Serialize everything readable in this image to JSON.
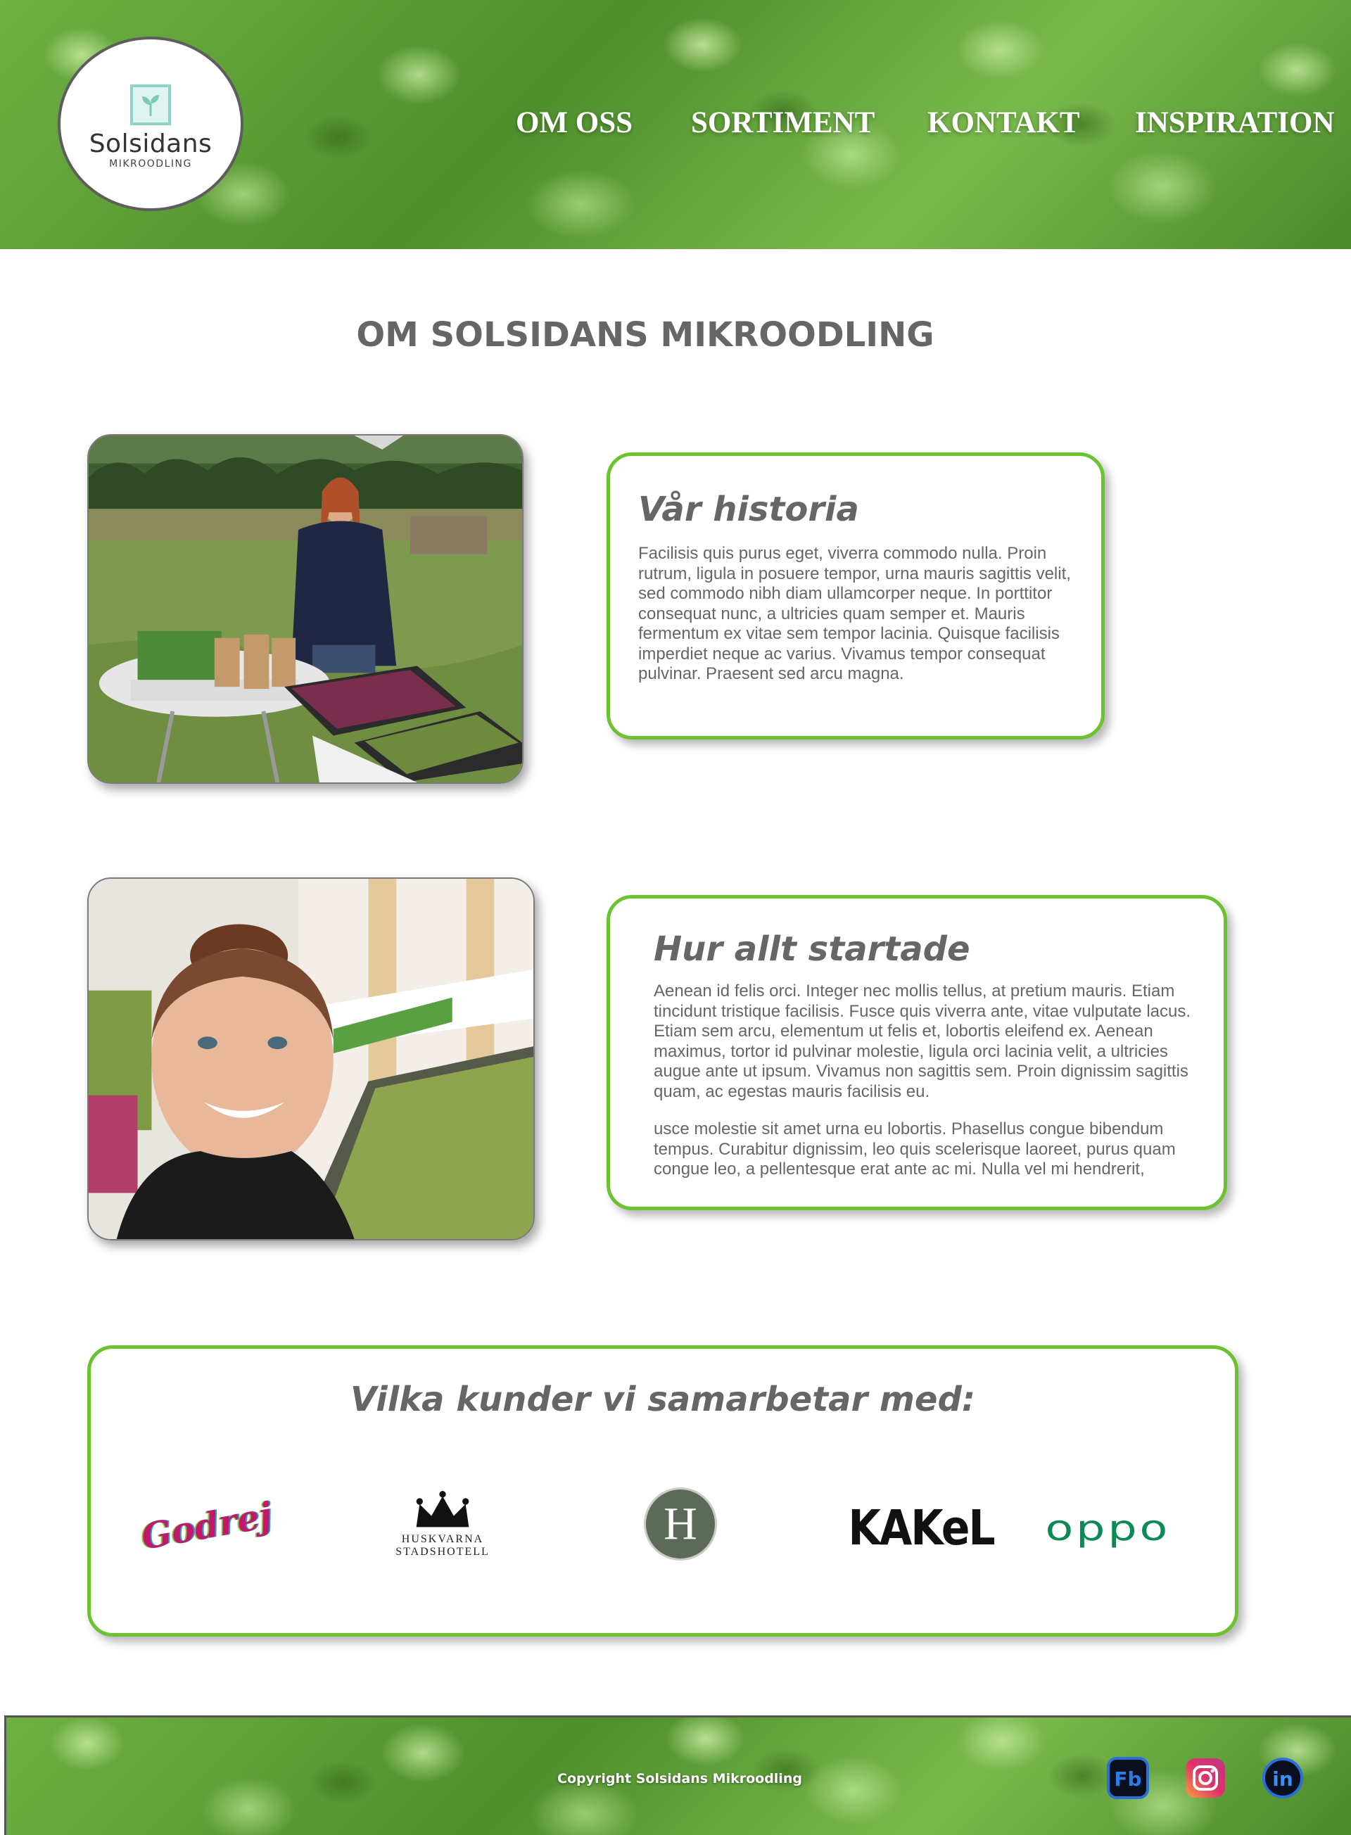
{
  "brand": {
    "name": "Solsidans",
    "tagline": "MIKROODLING"
  },
  "nav": {
    "items": [
      {
        "label": "OM OSS"
      },
      {
        "label": "SORTIMENT"
      },
      {
        "label": "KONTAKT"
      },
      {
        "label": "INSPIRATION"
      }
    ]
  },
  "main": {
    "title": "OM SOLSIDANS MIKROODLING",
    "history": {
      "heading": "Vår historia",
      "text": "Facilisis quis purus eget, viverra commodo nulla. Proin rutrum, ligula in posuere tempor, urna mauris sagittis velit, sed commodo nibh diam ullamcorper neque. In porttitor consequat nunc, a ultricies quam semper et. Mauris fermentum ex vitae sem tempor lacinia. Quisque facilisis imperdiet neque ac varius. Vivamus tempor consequat pulvinar. Praesent sed arcu magna."
    },
    "start": {
      "heading": "Hur allt startade",
      "paragraph1": "Aenean id felis orci. Integer nec mollis tellus, at pretium mauris. Etiam tincidunt tristique facilisis. Fusce quis viverra ante, vitae vulputate lacus. Etiam sem arcu, elementum ut felis et, lobortis eleifend ex. Aenean maximus, tortor id pulvinar molestie, ligula orci lacinia velit, a ultricies augue ante ut ipsum. Vivamus non sagittis sem. Proin dignissim sagittis quam, ac egestas mauris facilisis eu.",
      "paragraph2": "usce molestie sit amet urna eu lobortis. Phasellus congue bibendum tempus. Curabitur dignissim, leo quis scelerisque laoreet, purus quam congue leo, a pellentesque erat ante ac mi. Nulla vel mi hendrerit,"
    },
    "partners": {
      "heading": "Vilka kunder vi samarbetar med:",
      "logos": [
        {
          "name": "godrej",
          "text": "Godrej"
        },
        {
          "name": "huskvarna-stadshotell",
          "line1": "HUSKVARNA",
          "line2": "STADSHOTELL"
        },
        {
          "name": "h-emblem",
          "text": "H"
        },
        {
          "name": "kakel",
          "text": "KAKeL"
        },
        {
          "name": "oppo",
          "text": "oppo"
        }
      ]
    }
  },
  "footer": {
    "copyright": "Copyright Solsidans Mikroodling",
    "social": [
      {
        "name": "facebook",
        "label": "Fb"
      },
      {
        "name": "instagram",
        "label": ""
      },
      {
        "name": "linkedin",
        "label": "in"
      }
    ]
  },
  "colors": {
    "accent_green": "#6cc22f",
    "text_gray": "#666666",
    "logo_teal": "#8fd3c7"
  }
}
